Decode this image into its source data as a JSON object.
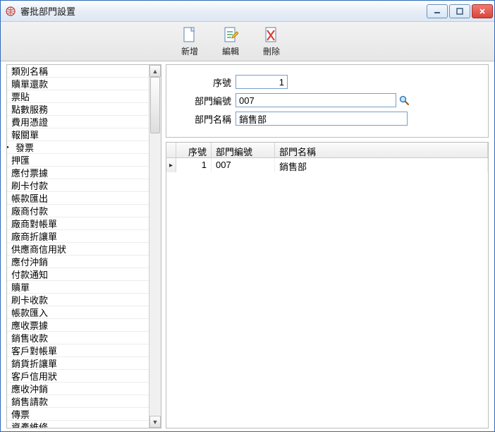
{
  "window": {
    "title": "審批部門設置"
  },
  "toolbar": {
    "add": "新增",
    "edit": "編輯",
    "delete": "刪除"
  },
  "sidebar": {
    "items": [
      "類別名稱",
      "贖單還款",
      "票貼",
      "點數服務",
      "費用憑證",
      "報關單",
      "發票",
      "押匯",
      "應付票據",
      "刷卡付款",
      "帳款匯出",
      "廠商付款",
      "廠商對帳單",
      "廠商折讓單",
      "供應商信用狀",
      "應付沖銷",
      "付款通知",
      "贖單",
      "刷卡收款",
      "帳款匯入",
      "應收票據",
      "銷售收款",
      "客戶對帳單",
      "銷貨折讓單",
      "客戶信用狀",
      "應收沖銷",
      "銷售請款",
      "傳票",
      "資產維修"
    ],
    "selected_index": 6
  },
  "form": {
    "seq_label": "序號",
    "code_label": "部門編號",
    "name_label": "部門名稱",
    "seq_value": "1",
    "code_value": "007",
    "name_value": "銷售部"
  },
  "grid": {
    "headers": {
      "seq": "序號",
      "code": "部門編號",
      "name": "部門名稱"
    },
    "rows": [
      {
        "seq": "1",
        "code": "007",
        "name": "銷售部"
      }
    ]
  },
  "icons": {
    "app": "globe-icon",
    "min": "minimize-icon",
    "max": "maximize-icon",
    "close": "close-icon",
    "add": "new-doc-icon",
    "edit": "edit-doc-icon",
    "delete": "delete-doc-icon",
    "lookup": "search-icon"
  }
}
